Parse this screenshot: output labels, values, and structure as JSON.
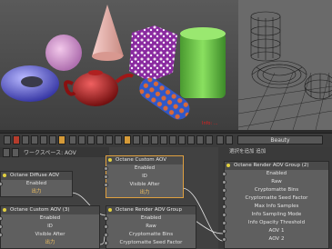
{
  "render_view": {
    "red_label": "Info: ..."
  },
  "toolbar": {
    "channel_value": "Beauty"
  },
  "node_editor": {
    "tab_label": "ワークスペース: AOV",
    "right_header": "選択を追加         追加",
    "nodes": {
      "diffuse": {
        "title": "Octane Diffuse AOV",
        "rows": [
          "Enabled",
          "出力"
        ]
      },
      "custom_top": {
        "title": "Octane Custom AOV",
        "rows": [
          "Enabled",
          "ID",
          "Visible After",
          "出力"
        ]
      },
      "custom3": {
        "title": "Octane Custom AOV (3)",
        "rows": [
          "Enabled",
          "ID",
          "Visible After",
          "出力"
        ]
      },
      "group_small": {
        "title": "Octane Render AOV Group",
        "rows": [
          "Enabled",
          "Raw",
          "Cryptomatte Bins",
          "Cryptomatte Seed Factor"
        ]
      },
      "group2": {
        "title": "Octane Render AOV Group (2)",
        "rows": [
          "Enabled",
          "Raw",
          "Cryptomatte Bins",
          "Cryptomatte Seed Factor",
          "Max Info Samples",
          "Info Sampling Mode",
          "Info Opacity Threshold",
          "AOV 1",
          "AOV 2"
        ]
      }
    }
  }
}
